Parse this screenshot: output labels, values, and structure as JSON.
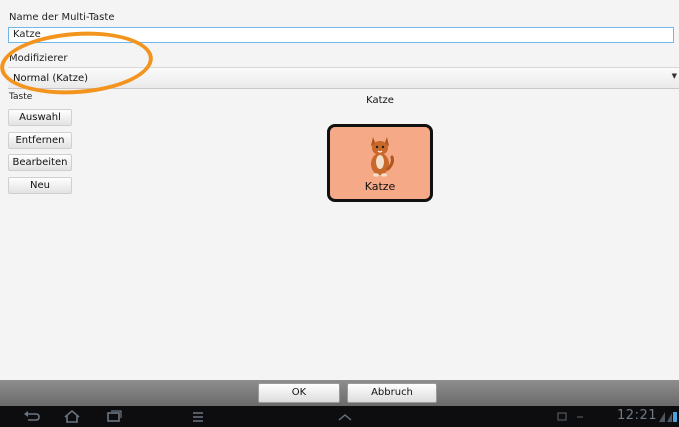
{
  "form": {
    "name_label": "Name der Multi-Taste",
    "name_value": "Katze",
    "modifier_label": "Modifizierer",
    "modifier_value": "Normal (Katze)",
    "key_label": "Taste"
  },
  "side_buttons": {
    "select": "Auswahl",
    "remove": "Entfernen",
    "edit": "Bearbeiten",
    "new": "Neu"
  },
  "preview": {
    "caption": "Katze",
    "tile_label": "Katze",
    "tile_color": "#f5a986"
  },
  "dialog_buttons": {
    "ok": "OK",
    "cancel": "Abbruch"
  },
  "status_bar": {
    "time": "12:21"
  },
  "colors": {
    "highlight": "#f3941e",
    "field_border": "#6fb8ec"
  }
}
